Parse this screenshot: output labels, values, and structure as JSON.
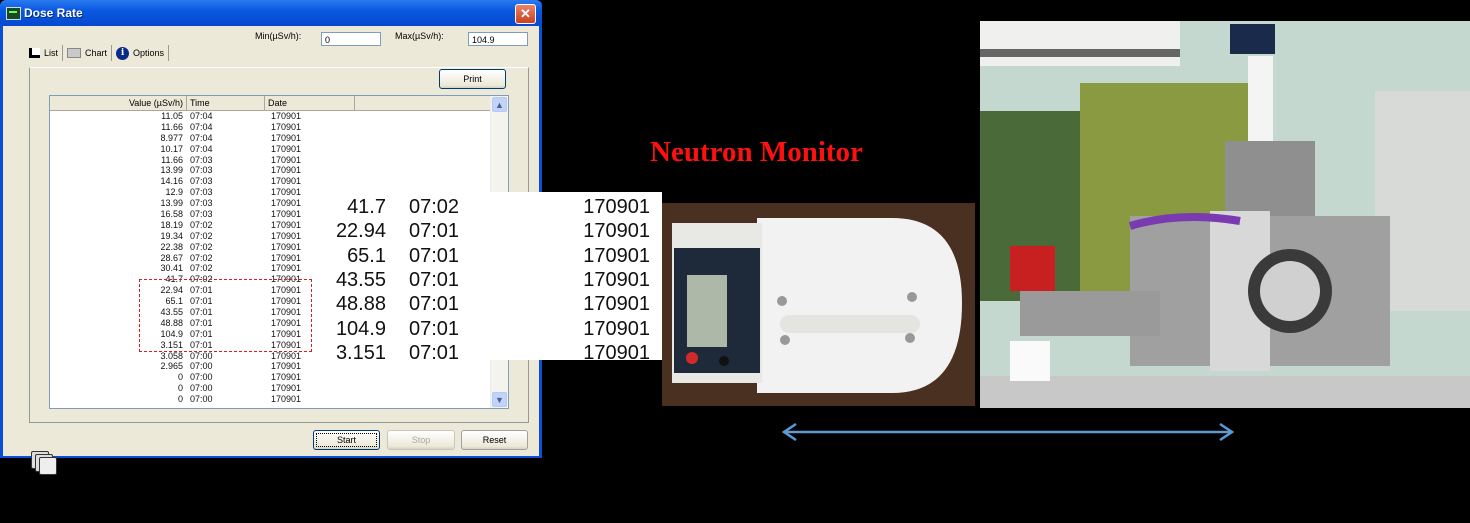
{
  "window": {
    "title": "Dose Rate",
    "close_label": "✕",
    "min_label": "Min(µSv/h):",
    "min_value": "0",
    "max_label": "Max(µSv/h):",
    "max_value": "104.9",
    "tabs": [
      {
        "label": "List",
        "icon": "list-icon",
        "active": true
      },
      {
        "label": "Chart",
        "icon": "chart-icon",
        "active": false
      },
      {
        "label": "Options",
        "icon": "info-icon",
        "active": false
      }
    ],
    "print_label": "Print",
    "columns": [
      "Value (µSv/h)",
      "Time",
      "Date"
    ],
    "rows": [
      [
        "11.05",
        "07:04",
        "170901"
      ],
      [
        "11.66",
        "07:04",
        "170901"
      ],
      [
        "8.977",
        "07:04",
        "170901"
      ],
      [
        "10.17",
        "07:04",
        "170901"
      ],
      [
        "11.66",
        "07:03",
        "170901"
      ],
      [
        "13.99",
        "07:03",
        "170901"
      ],
      [
        "14.16",
        "07:03",
        "170901"
      ],
      [
        "12.9",
        "07:03",
        "170901"
      ],
      [
        "13.99",
        "07:03",
        "170901"
      ],
      [
        "16.58",
        "07:03",
        "170901"
      ],
      [
        "18.19",
        "07:02",
        "170901"
      ],
      [
        "19.34",
        "07:02",
        "170901"
      ],
      [
        "22.38",
        "07:02",
        "170901"
      ],
      [
        "28.67",
        "07:02",
        "170901"
      ],
      [
        "30.41",
        "07:02",
        "170901"
      ],
      [
        "41.7",
        "07:02",
        "170901"
      ],
      [
        "22.94",
        "07:01",
        "170901"
      ],
      [
        "65.1",
        "07:01",
        "170901"
      ],
      [
        "43.55",
        "07:01",
        "170901"
      ],
      [
        "48.88",
        "07:01",
        "170901"
      ],
      [
        "104.9",
        "07:01",
        "170901"
      ],
      [
        "3.151",
        "07:01",
        "170901"
      ],
      [
        "3.058",
        "07:00",
        "170901"
      ],
      [
        "2.965",
        "07:00",
        "170901"
      ],
      [
        "0",
        "07:00",
        "170901"
      ],
      [
        "0",
        "07:00",
        "170901"
      ],
      [
        "0",
        "07:00",
        "170901"
      ]
    ],
    "scroll_up": "︿",
    "scroll_down": "﹀",
    "start_label": "Start",
    "stop_label": "Stop",
    "reset_label": "Reset"
  },
  "magnified": {
    "rows": [
      [
        "41.7",
        "07:02",
        "170901"
      ],
      [
        "22.94",
        "07:01",
        "170901"
      ],
      [
        "65.1",
        "07:01",
        "170901"
      ],
      [
        "43.55",
        "07:01",
        "170901"
      ],
      [
        "48.88",
        "07:01",
        "170901"
      ],
      [
        "104.9",
        "07:01",
        "170901"
      ],
      [
        "3.151",
        "07:01",
        "170901"
      ]
    ]
  },
  "heading": "Neutron Monitor",
  "colors": {
    "heading": "#ff1010",
    "arrow": "#5b9bd5",
    "highlight": "#d02020"
  }
}
